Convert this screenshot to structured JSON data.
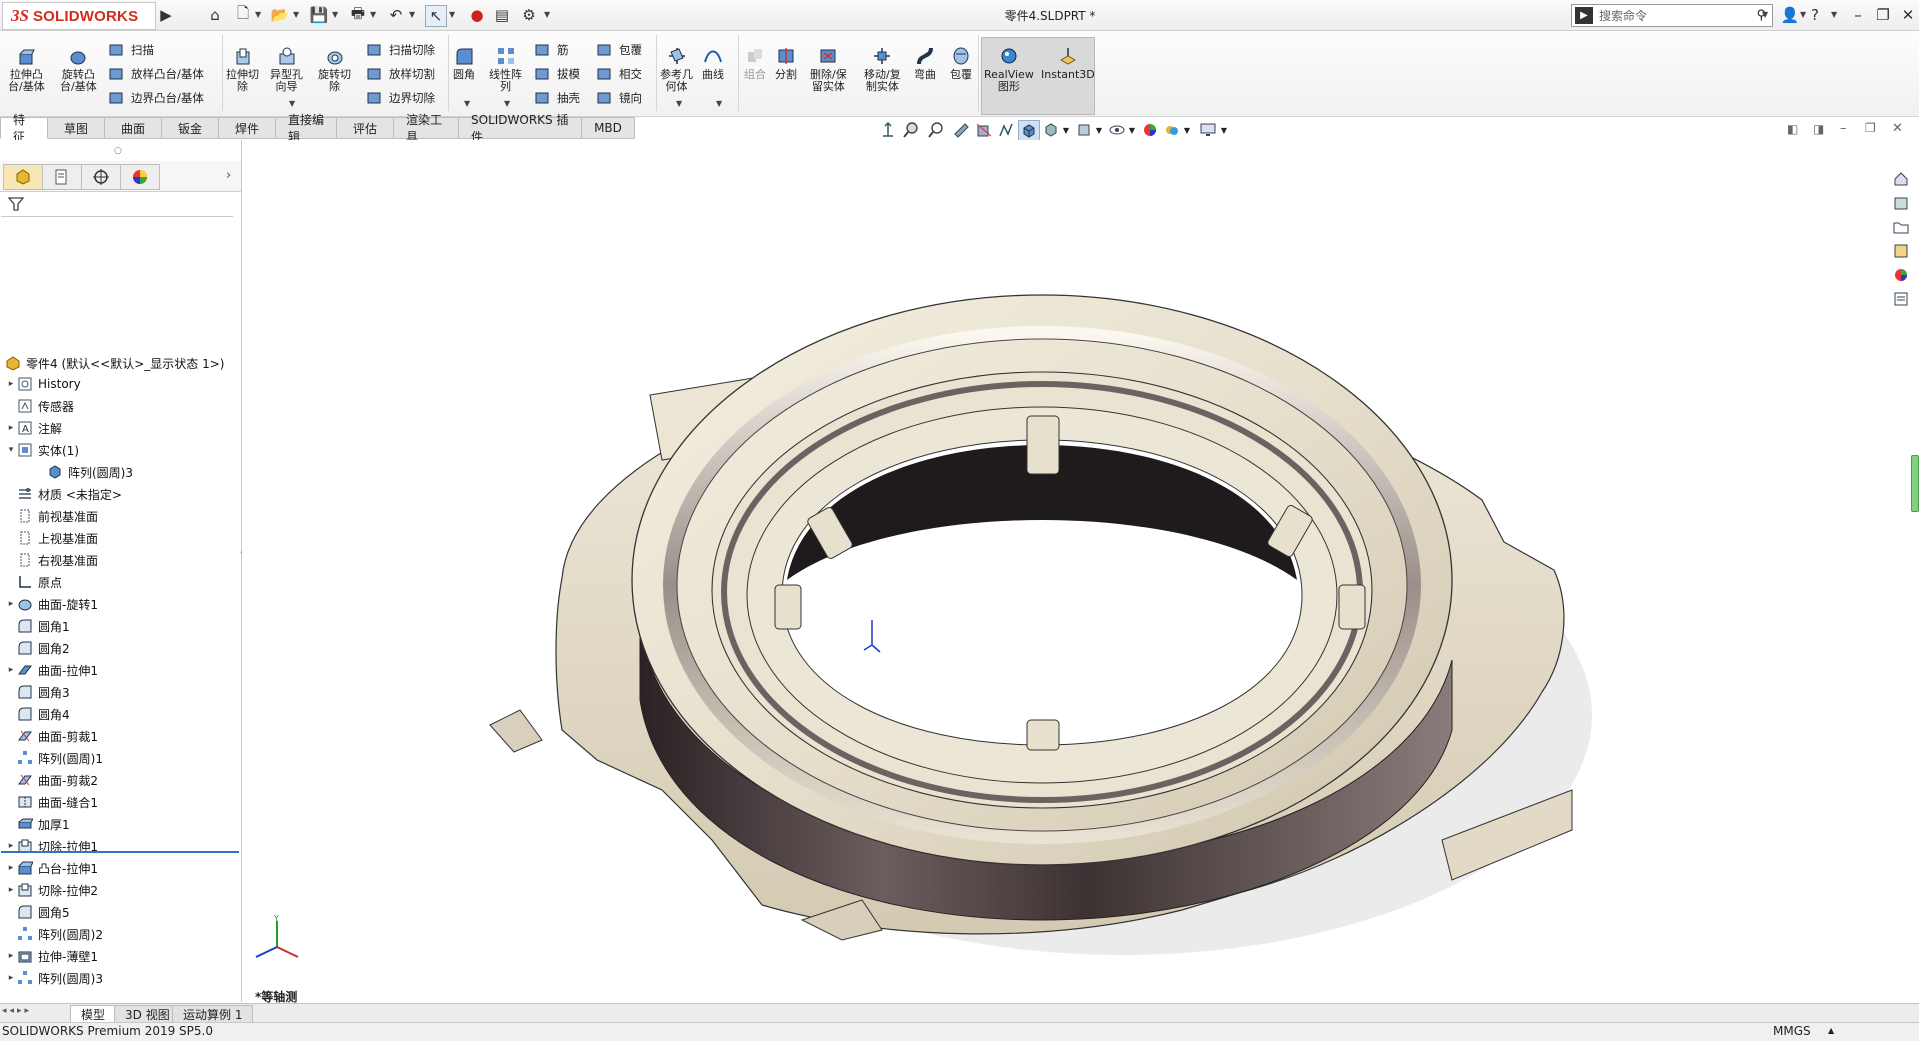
{
  "app": {
    "logo_ds": "3S",
    "logo_text": "SOLIDWORKS",
    "document_title": "零件4.SLDPRT *",
    "search_placeholder": "搜索命令"
  },
  "ribbon": {
    "big": [
      {
        "id": "extrude-boss",
        "label": "拉伸凸\n台/基体"
      },
      {
        "id": "revolve-boss",
        "label": "旋转凸\n台/基体"
      },
      {
        "id": "extrude-cut",
        "label": "拉伸切\n除"
      },
      {
        "id": "hole-wizard",
        "label": "异型孔\n向导"
      },
      {
        "id": "revolve-cut",
        "label": "旋转切\n除"
      },
      {
        "id": "fillet",
        "label": "圆角"
      },
      {
        "id": "linear-pattern",
        "label": "线性阵\n列"
      },
      {
        "id": "ref-geometry",
        "label": "参考几\n何体"
      },
      {
        "id": "curves",
        "label": "曲线"
      },
      {
        "id": "combine",
        "label": "组合"
      },
      {
        "id": "split",
        "label": "分割"
      },
      {
        "id": "delete-body",
        "label": "删除/保\n留实体"
      },
      {
        "id": "move-copy",
        "label": "移动/复\n制实体"
      },
      {
        "id": "flex",
        "label": "弯曲"
      },
      {
        "id": "wrap2",
        "label": "包覆"
      },
      {
        "id": "realview",
        "label": "RealView\n图形"
      },
      {
        "id": "instant3d",
        "label": "Instant3D"
      }
    ],
    "small": [
      {
        "id": "sweep",
        "label": "扫描"
      },
      {
        "id": "loft-boss",
        "label": "放样凸台/基体"
      },
      {
        "id": "boundary-boss",
        "label": "边界凸台/基体"
      },
      {
        "id": "swept-cut",
        "label": "扫描切除"
      },
      {
        "id": "lofted-cut",
        "label": "放样切割"
      },
      {
        "id": "boundary-cut",
        "label": "边界切除"
      },
      {
        "id": "rib",
        "label": "筋"
      },
      {
        "id": "draft",
        "label": "拔模"
      },
      {
        "id": "shell",
        "label": "抽壳"
      },
      {
        "id": "wrap",
        "label": "包覆"
      },
      {
        "id": "intersect",
        "label": "相交"
      },
      {
        "id": "mirror",
        "label": "镜向"
      }
    ]
  },
  "tabs": [
    "特征",
    "草图",
    "曲面",
    "钣金",
    "焊件",
    "直接编辑",
    "评估",
    "渲染工具",
    "SOLIDWORKS 插件",
    "MBD"
  ],
  "tree": {
    "root": "零件4 (默认<<默认>_显示状态 1>)",
    "items": [
      {
        "label": "History",
        "icon": "history-icon",
        "exp": true,
        "indent": 0
      },
      {
        "label": "传感器",
        "icon": "sensor-icon",
        "exp": false,
        "indent": 0
      },
      {
        "label": "注解",
        "icon": "annotation-icon",
        "exp": true,
        "indent": 0
      },
      {
        "label": "实体(1)",
        "icon": "solid-bodies-icon",
        "exp": "open",
        "indent": 0
      },
      {
        "label": "阵列(圆周)3",
        "icon": "body-icon",
        "exp": false,
        "indent": 1
      },
      {
        "label": "材质 <未指定>",
        "icon": "material-icon",
        "exp": false,
        "indent": 0
      },
      {
        "label": "前视基准面",
        "icon": "plane-icon",
        "exp": false,
        "indent": 0
      },
      {
        "label": "上视基准面",
        "icon": "plane-icon",
        "exp": false,
        "indent": 0
      },
      {
        "label": "右视基准面",
        "icon": "plane-icon",
        "exp": false,
        "indent": 0
      },
      {
        "label": "原点",
        "icon": "origin-icon",
        "exp": false,
        "indent": 0
      },
      {
        "label": "曲面-旋转1",
        "icon": "surface-revolve-icon",
        "exp": true,
        "indent": 0
      },
      {
        "label": "圆角1",
        "icon": "fillet-icon",
        "exp": false,
        "indent": 0
      },
      {
        "label": "圆角2",
        "icon": "fillet-icon",
        "exp": false,
        "indent": 0
      },
      {
        "label": "曲面-拉伸1",
        "icon": "surface-extrude-icon",
        "exp": true,
        "indent": 0
      },
      {
        "label": "圆角3",
        "icon": "fillet-icon",
        "exp": false,
        "indent": 0
      },
      {
        "label": "圆角4",
        "icon": "fillet-icon",
        "exp": false,
        "indent": 0
      },
      {
        "label": "曲面-剪裁1",
        "icon": "surface-trim-icon",
        "exp": false,
        "indent": 0
      },
      {
        "label": "阵列(圆周)1",
        "icon": "circular-pattern-icon",
        "exp": false,
        "indent": 0
      },
      {
        "label": "曲面-剪裁2",
        "icon": "surface-trim-icon",
        "exp": false,
        "indent": 0
      },
      {
        "label": "曲面-缝合1",
        "icon": "surface-knit-icon",
        "exp": false,
        "indent": 0
      },
      {
        "label": "加厚1",
        "icon": "thicken-icon",
        "exp": false,
        "indent": 0
      },
      {
        "label": "切除-拉伸1",
        "icon": "cut-extrude-icon",
        "exp": true,
        "indent": 0
      },
      {
        "label": "凸台-拉伸1",
        "icon": "boss-extrude-icon",
        "exp": true,
        "indent": 0
      },
      {
        "label": "切除-拉伸2",
        "icon": "cut-extrude-icon",
        "exp": true,
        "indent": 0
      },
      {
        "label": "圆角5",
        "icon": "fillet-icon",
        "exp": false,
        "indent": 0
      },
      {
        "label": "阵列(圆周)2",
        "icon": "circular-pattern-icon",
        "exp": false,
        "indent": 0
      },
      {
        "label": "拉伸-薄壁1",
        "icon": "thin-extrude-icon",
        "exp": true,
        "indent": 0
      },
      {
        "label": "阵列(圆周)3",
        "icon": "circular-pattern-icon",
        "exp": true,
        "indent": 0
      }
    ]
  },
  "viewport": {
    "view_label": "*等轴测"
  },
  "bottom_tabs": [
    "模型",
    "3D 视图",
    "运动算例 1"
  ],
  "status": {
    "version": "SOLIDWORKS Premium 2019 SP5.0",
    "units": "MMGS"
  }
}
